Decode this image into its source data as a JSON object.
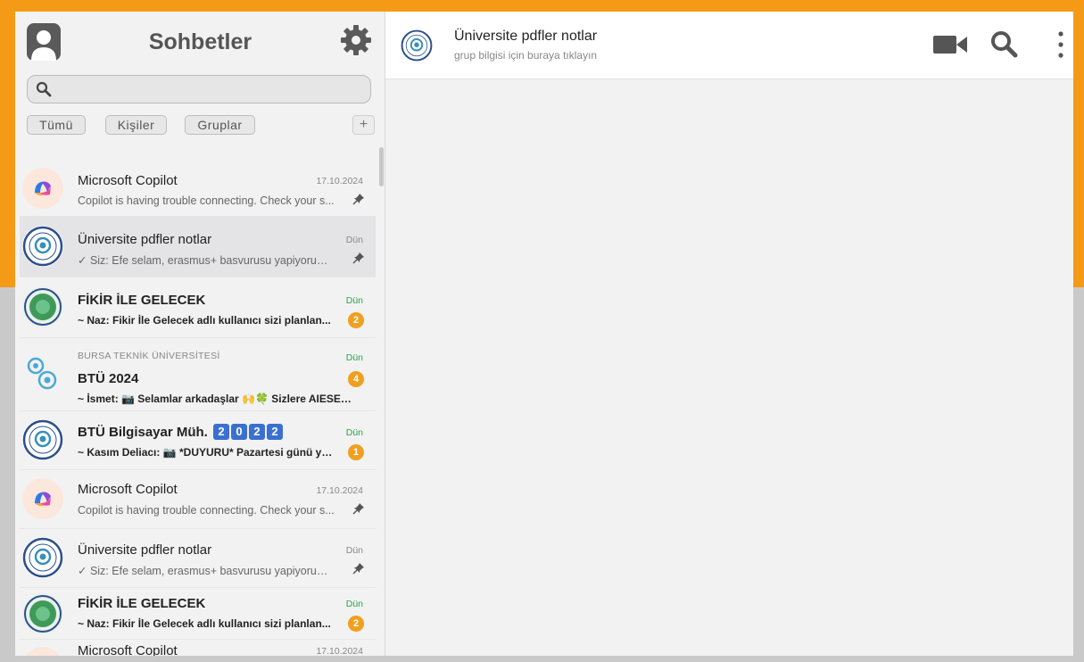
{
  "sidebar": {
    "title": "Sohbetler",
    "search_placeholder": "",
    "filters": [
      "Tümü",
      "Kişiler",
      "Gruplar"
    ],
    "add_label": "+"
  },
  "chats": [
    {
      "name": "Microsoft Copilot",
      "date": "17.10.2024",
      "preview": "Copilot is having trouble connecting. Check your s...",
      "avatar": "copilot",
      "pinned": true
    },
    {
      "name": "Üniversite pdfler notlar",
      "date": "Dün",
      "preview": "✓ Siz: Efe selam, erasmus+ basvurusu yapiyorum, ...",
      "avatar": "btu",
      "pinned": true
    },
    {
      "name": "FİKİR İLE GELECEK",
      "date": "Dün",
      "preview": "~ Naz: Fikir İle Gelecek adlı kullanıcı sizi planlan...",
      "avatar": "fikir",
      "badge": "2"
    },
    {
      "community": "BURSA TEKNİK ÜNİVERSİTESİ",
      "name": "BTÜ 2024",
      "date": "Dün",
      "preview": "~ İsmet: 📷 Selamlar arkadaşlar 🙌🍀 Sizlere AIESEC...",
      "avatar": "community",
      "badge": "4"
    },
    {
      "name": "BTÜ Bilgisayar Müh.",
      "name_boxes": [
        "2",
        "0",
        "2",
        "2"
      ],
      "date": "Dün",
      "preview": "~ Kasım Deliacı: 📷 *DUYURU* Pazartesi günü ya...",
      "avatar": "btu",
      "badge": "1"
    },
    {
      "name": "Microsoft Copilot",
      "date": "17.10.2024",
      "preview": "Copilot is having trouble connecting. Check your s...",
      "avatar": "copilot",
      "pinned": true
    },
    {
      "name": "Üniversite pdfler notlar",
      "date": "Dün",
      "preview": "✓ Siz: Efe selam, erasmus+ basvurusu yapiyorum, ...",
      "avatar": "btu",
      "pinned": true
    },
    {
      "name": "FİKİR İLE GELECEK",
      "date": "Dün",
      "preview": "~ Naz: Fikir İle Gelecek adlı kullanıcı sizi planlan...",
      "avatar": "fikir",
      "badge": "2"
    },
    {
      "name": "Microsoft Copilot",
      "date": "17.10.2024",
      "preview": "",
      "avatar": "copilot"
    }
  ],
  "main": {
    "title": "Üniversite pdfler notlar",
    "subtitle": "grup bilgisi için buraya tıklayın"
  },
  "colors": {
    "frame_accent": "#f59a16",
    "badge": "#f0a020",
    "unread_date": "#2aa54a"
  }
}
